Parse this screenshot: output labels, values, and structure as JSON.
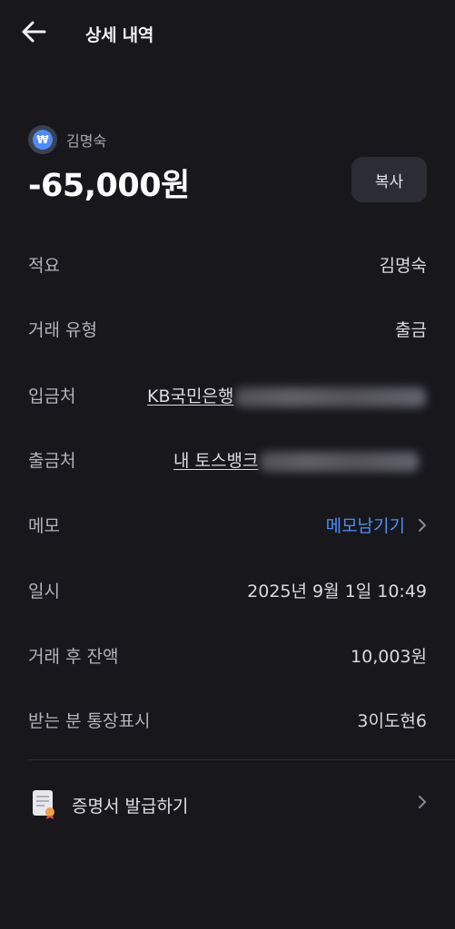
{
  "header": {
    "title": "상세 내역",
    "back_icon": "arrow-left-icon"
  },
  "summary": {
    "account_icon": "won-icon",
    "account_icon_glyph": "₩",
    "account_name": "김명숙",
    "amount": "-65,000원",
    "copy_label": "복사"
  },
  "details": [
    {
      "label": "적요",
      "value": "김명숙"
    },
    {
      "label": "거래 유형",
      "value": "출금"
    },
    {
      "label": "입금처",
      "value": "KB국민은행"
    },
    {
      "label": "출금처",
      "value": "내 토스뱅크"
    },
    {
      "label": "메모",
      "value": "메모남기기"
    },
    {
      "label": "일시",
      "value": "2025년 9월 1일 10:49"
    },
    {
      "label": "거래 후 잔액",
      "value": "10,003원"
    },
    {
      "label": "받는 분 통장표시",
      "value": "3이도현6"
    }
  ],
  "certificate": {
    "label": "증명서 발급하기",
    "icon": "certificate-icon"
  },
  "colors": {
    "background": "#17171c",
    "accent": "#4f8cf7",
    "button_bg": "#2c2c35"
  }
}
